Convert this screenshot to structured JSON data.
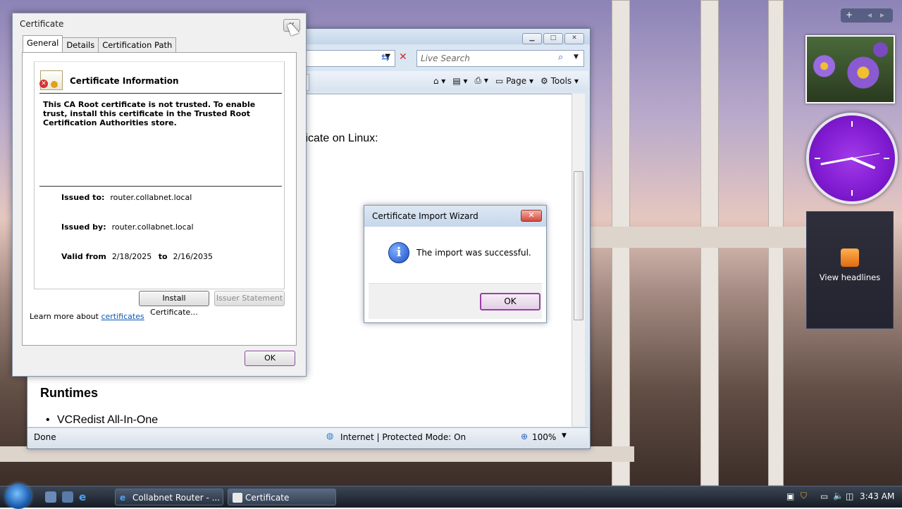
{
  "desktop": {
    "sidebar_controls": {
      "add": "+",
      "prev": "◂",
      "next": "▸"
    },
    "feed_gadget": {
      "label": "View headlines"
    }
  },
  "ie": {
    "search_placeholder": "Live Search",
    "toolbar": {
      "page_label": "Page",
      "tools_label": "Tools"
    },
    "content": {
      "linux_heading": "ficate on Linux:",
      "runtimes_heading": "Runtimes",
      "bullet_item": "VCRedist All-In-One"
    },
    "status": {
      "text": "Done",
      "zone": "Internet | Protected Mode: On",
      "zoom": "100%"
    }
  },
  "cert_dialog": {
    "title": "Certificate",
    "close_glyph": "✕",
    "tabs": [
      "General",
      "Details",
      "Certification Path"
    ],
    "info_heading": "Certificate Information",
    "warning": "This CA Root certificate is not trusted. To enable trust, install this certificate in the Trusted Root Certification Authorities store.",
    "issued_to_label": "Issued to:",
    "issued_to_value": "router.collabnet.local",
    "issued_by_label": "Issued by:",
    "issued_by_value": "router.collabnet.local",
    "valid_from_label": "Valid from",
    "valid_from_value": "2/18/2025",
    "valid_to_label": "to",
    "valid_to_value": "2/16/2035",
    "install_button": "Install Certificate...",
    "issuer_button": "Issuer Statement",
    "learn_more_prefix": "Learn more about",
    "learn_more_link": "certificates",
    "ok_button": "OK"
  },
  "wizard": {
    "title": "Certificate Import Wizard",
    "close_glyph": "✕",
    "message": "The import was successful.",
    "ok_button": "OK",
    "info_glyph": "i"
  },
  "taskbar": {
    "tasks": [
      "Collabnet Router - ...",
      "Certificate"
    ],
    "clock": "3:43 AM"
  },
  "colors": {
    "link": "#0b59b3",
    "wizard_ok_border": "#9a3ea8",
    "clock_face": "#8a22da"
  }
}
